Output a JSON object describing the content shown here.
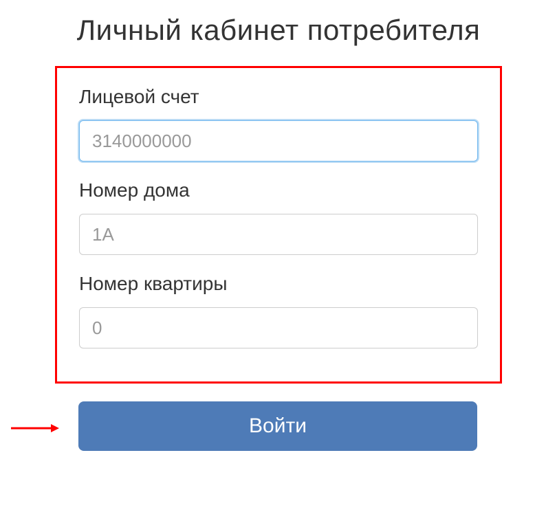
{
  "title": "Личный кабинет потребителя",
  "form": {
    "account_label": "Лицевой счет",
    "account_placeholder": "3140000000",
    "house_label": "Номер дома",
    "house_placeholder": "1А",
    "apartment_label": "Номер квартиры",
    "apartment_placeholder": "0"
  },
  "submit_label": "Войти"
}
